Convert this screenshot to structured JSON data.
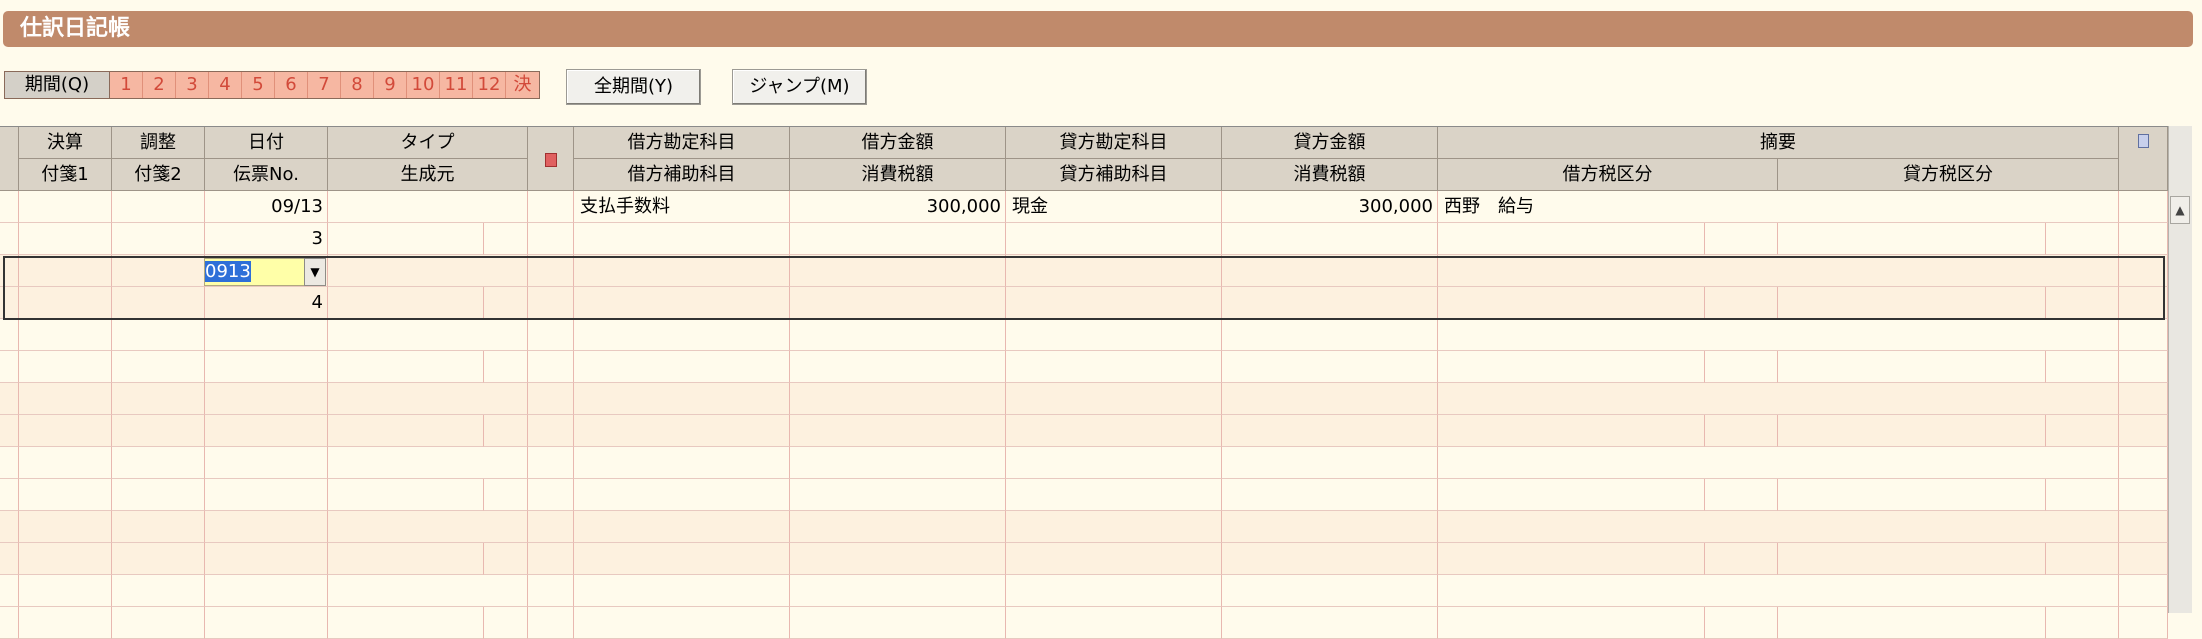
{
  "title": "仕訳日記帳",
  "period": {
    "label": "期間(Q)",
    "buttons": [
      "1",
      "2",
      "3",
      "4",
      "5",
      "6",
      "7",
      "8",
      "9",
      "10",
      "11",
      "12",
      "決"
    ]
  },
  "buttons": {
    "all_period": "全期間(Y)",
    "jump": "ジャンプ(M)"
  },
  "headers": {
    "row1": [
      "決算",
      "調整",
      "日付",
      "タイプ",
      "借方勘定科目",
      "借方金額",
      "貸方勘定科目",
      "貸方金額",
      "摘要"
    ],
    "row2": [
      "付箋1",
      "付箋2",
      "伝票No.",
      "生成元",
      "借方補助科目",
      "消費税額",
      "貸方補助科目",
      "消費税額",
      "借方税区分",
      "貸方税区分"
    ]
  },
  "entries": [
    {
      "date": "09/13",
      "voucher_no": "3",
      "debit_account": "支払手数料",
      "debit_amount": "300,000",
      "credit_account": "現金",
      "credit_amount": "300,000",
      "memo": "西野　給与"
    },
    {
      "date_input": "0913",
      "voucher_no": "4"
    }
  ],
  "icons": {
    "header_mark": "red-note-icon",
    "header_right": "clipboard-icon",
    "dropdown": "chevron-down-icon",
    "scroll_up": "scroll-up-arrow-icon"
  },
  "colors": {
    "title_bar": "#c08a6b",
    "background": "#fffbec",
    "period_buttons": "#f6b7a2",
    "header": "#dad3c7"
  }
}
